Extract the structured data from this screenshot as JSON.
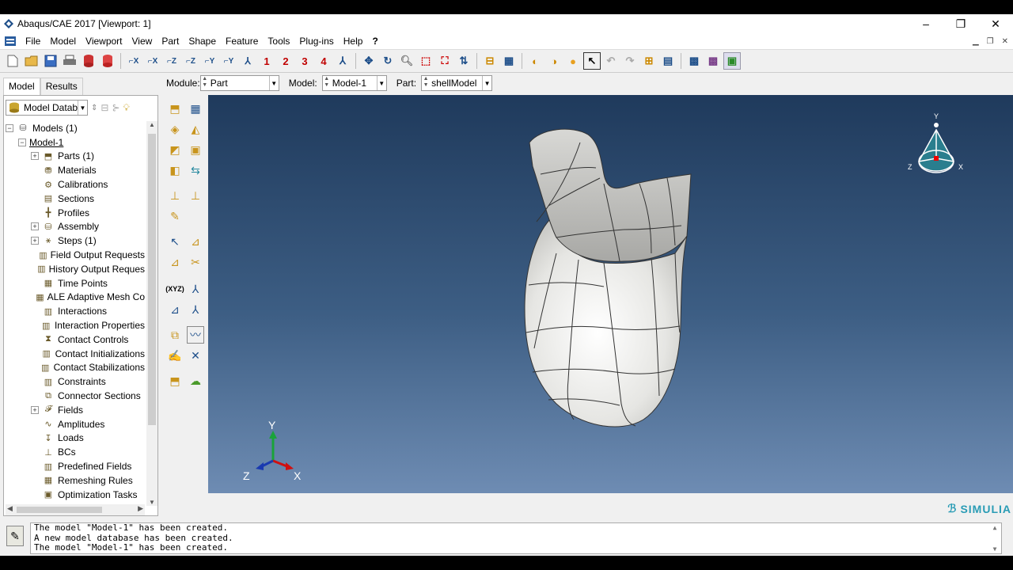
{
  "window": {
    "title": "Abaqus/CAE 2017 [Viewport: 1]",
    "minimize": "–",
    "maximize": "❐",
    "close": "✕"
  },
  "menu": [
    "File",
    "Model",
    "Viewport",
    "View",
    "Part",
    "Shape",
    "Feature",
    "Tools",
    "Plug-ins",
    "Help",
    "?"
  ],
  "tabs": {
    "model": "Model",
    "results": "Results"
  },
  "context": {
    "module_label": "Module:",
    "module_value": "Part",
    "model_label": "Model:",
    "model_value": "Model-1",
    "part_label": "Part:",
    "part_value": "shellModel"
  },
  "database": {
    "value": "Model Databa"
  },
  "tree": {
    "root": "Models (1)",
    "model": "Model-1",
    "items": [
      {
        "label": "Parts (1)",
        "expandable": true,
        "icon": "parts-icon"
      },
      {
        "label": "Materials",
        "expandable": false,
        "icon": "materials-icon"
      },
      {
        "label": "Calibrations",
        "expandable": false,
        "icon": "calibrations-icon"
      },
      {
        "label": "Sections",
        "expandable": false,
        "icon": "sections-icon"
      },
      {
        "label": "Profiles",
        "expandable": false,
        "icon": "profiles-icon"
      },
      {
        "label": "Assembly",
        "expandable": true,
        "icon": "assembly-icon"
      },
      {
        "label": "Steps (1)",
        "expandable": true,
        "icon": "steps-icon"
      },
      {
        "label": "Field Output Requests",
        "expandable": false,
        "icon": "field-output-icon"
      },
      {
        "label": "History Output Reques",
        "expandable": false,
        "icon": "history-output-icon"
      },
      {
        "label": "Time Points",
        "expandable": false,
        "icon": "time-points-icon"
      },
      {
        "label": "ALE Adaptive Mesh Co",
        "expandable": false,
        "icon": "ale-mesh-icon"
      },
      {
        "label": "Interactions",
        "expandable": false,
        "icon": "interactions-icon"
      },
      {
        "label": "Interaction Properties",
        "expandable": false,
        "icon": "interaction-properties-icon"
      },
      {
        "label": "Contact Controls",
        "expandable": false,
        "icon": "contact-controls-icon"
      },
      {
        "label": "Contact Initializations",
        "expandable": false,
        "icon": "contact-init-icon"
      },
      {
        "label": "Contact Stabilizations",
        "expandable": false,
        "icon": "contact-stab-icon"
      },
      {
        "label": "Constraints",
        "expandable": false,
        "icon": "constraints-icon"
      },
      {
        "label": "Connector Sections",
        "expandable": false,
        "icon": "connector-icon"
      },
      {
        "label": "Fields",
        "expandable": true,
        "icon": "fields-icon"
      },
      {
        "label": "Amplitudes",
        "expandable": false,
        "icon": "amplitudes-icon"
      },
      {
        "label": "Loads",
        "expandable": false,
        "icon": "loads-icon"
      },
      {
        "label": "BCs",
        "expandable": false,
        "icon": "bcs-icon"
      },
      {
        "label": "Predefined Fields",
        "expandable": false,
        "icon": "predefined-icon"
      },
      {
        "label": "Remeshing Rules",
        "expandable": false,
        "icon": "remeshing-icon"
      },
      {
        "label": "Optimization Tasks",
        "expandable": false,
        "icon": "optimization-icon"
      }
    ]
  },
  "toolbar_numbers": [
    "1",
    "2",
    "3",
    "4"
  ],
  "triad": {
    "x": "X",
    "y": "Y",
    "z": "Z"
  },
  "brand": "SIMULIA",
  "messages": [
    "The model \"Model-1\" has been created.",
    "A new model database has been created.",
    "The model \"Model-1\" has been created."
  ],
  "colors": {
    "viewport_top": "#1f3a5c",
    "viewport_bottom": "#6e8cb3",
    "brand": "#2a9cb5",
    "toolbar_number": "#c00000"
  }
}
